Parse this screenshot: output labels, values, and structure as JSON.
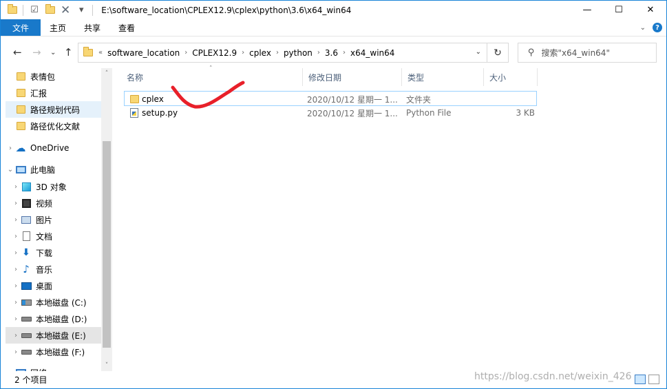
{
  "window": {
    "title": "E:\\software_location\\CPLEX12.9\\cplex\\python\\3.6\\x64_win64",
    "controls": {
      "minimize": "—",
      "maximize": "☐",
      "close": "✕"
    }
  },
  "quick_access": {
    "dropdown": "▾"
  },
  "ribbon": {
    "tabs": [
      "文件",
      "主页",
      "共享",
      "查看"
    ],
    "expand": "⌄",
    "help": "?"
  },
  "nav_buttons": {
    "back": "←",
    "forward": "→",
    "recent": "⌄",
    "up": "↑"
  },
  "address": {
    "overflow": "«",
    "crumbs": [
      "software_location",
      "CPLEX12.9",
      "cplex",
      "python",
      "3.6",
      "x64_win64"
    ],
    "separator": "›",
    "dropdown": "⌄",
    "refresh": "↻"
  },
  "search": {
    "placeholder": "搜索\"x64_win64\"",
    "icon": "search-icon"
  },
  "nav_pane": {
    "items": [
      {
        "label": "表情包",
        "icon": "folder-icon",
        "expander": ""
      },
      {
        "label": "汇报",
        "icon": "folder-icon",
        "expander": ""
      },
      {
        "label": "路径规划代码",
        "icon": "folder-icon",
        "expander": ""
      },
      {
        "label": "路径优化文献",
        "icon": "folder-icon",
        "expander": ""
      },
      {
        "label": "OneDrive",
        "icon": "onedrive-icon",
        "expander": "›"
      },
      {
        "label": "此电脑",
        "icon": "this-pc-icon",
        "expander": "⌄"
      },
      {
        "label": "3D 对象",
        "icon": "3d-objects-icon",
        "expander": "›"
      },
      {
        "label": "视频",
        "icon": "videos-icon",
        "expander": "›"
      },
      {
        "label": "图片",
        "icon": "pictures-icon",
        "expander": "›"
      },
      {
        "label": "文档",
        "icon": "documents-icon",
        "expander": "›"
      },
      {
        "label": "下载",
        "icon": "downloads-icon",
        "expander": "›"
      },
      {
        "label": "音乐",
        "icon": "music-icon",
        "expander": "›"
      },
      {
        "label": "桌面",
        "icon": "desktop-icon",
        "expander": "›"
      },
      {
        "label": "本地磁盘 (C:)",
        "icon": "drive-c-icon",
        "expander": "›"
      },
      {
        "label": "本地磁盘 (D:)",
        "icon": "drive-icon",
        "expander": "›"
      },
      {
        "label": "本地磁盘 (E:)",
        "icon": "drive-icon",
        "expander": "›"
      },
      {
        "label": "本地磁盘 (F:)",
        "icon": "drive-icon",
        "expander": "›"
      },
      {
        "label": "网络",
        "icon": "network-icon",
        "expander": "›"
      }
    ],
    "scroll": {
      "up": "˄",
      "down": "˅"
    }
  },
  "columns": {
    "name": "名称",
    "modified": "修改日期",
    "type": "类型",
    "size": "大小",
    "sort_indicator": "˄"
  },
  "files": [
    {
      "name": "cplex",
      "modified": "2020/10/12 星期一 1...",
      "type": "文件夹",
      "size": "",
      "icon": "folder-icon"
    },
    {
      "name": "setup.py",
      "modified": "2020/10/12 星期一 1...",
      "type": "Python File",
      "size": "3 KB",
      "icon": "python-file-icon"
    }
  ],
  "status": {
    "count": "2 个项目"
  },
  "watermark": "https://blog.csdn.net/weixin_426",
  "colors": {
    "accent": "#1979ca",
    "selection_border": "#99d1ff",
    "annotation": "#e8202a"
  }
}
